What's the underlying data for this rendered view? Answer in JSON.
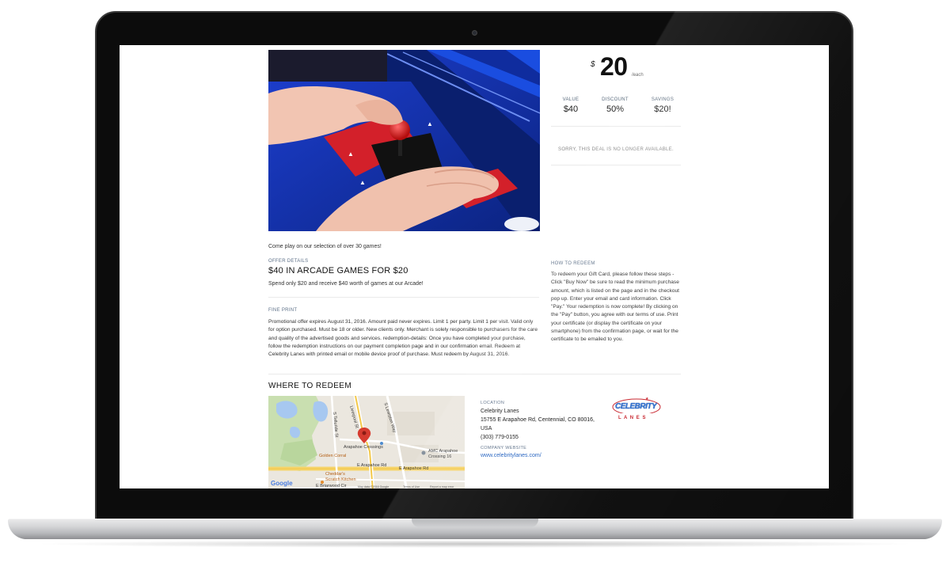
{
  "deal": {
    "currency_symbol": "$",
    "price": "20",
    "price_unit": "/each",
    "stats": [
      {
        "label": "VALUE",
        "value": "$40"
      },
      {
        "label": "DISCOUNT",
        "value": "50%"
      },
      {
        "label": "SAVINGS",
        "value": "$20!"
      }
    ],
    "status_message": "SORRY, THIS DEAL IS NO LONGER AVAILABLE."
  },
  "content": {
    "intro": "Come play on our selection of over 30 games!",
    "offer_details_label": "OFFER DETAILS",
    "offer_title": "$40 IN ARCADE GAMES FOR $20",
    "offer_description": "Spend only $20 and receive $40 worth of games at our Arcade!",
    "fine_print_label": "FINE PRINT",
    "fine_print": "Promotional offer expires August 31, 2016. Amount paid never expires. Limit 1 per party. Limit 1 per visit. Valid only for option purchased. Must be 18 or older. New clients only. Merchant is solely responsible to purchasers for the care and quality of the advertised goods and services. redemption-details: Once you have completed your purchase, follow the redemption instructions on our payment completion page and in our confirmation email. Redeem at Celebrity Lanes with printed email or mobile device proof of purchase. Must redeem by August 31, 2016.",
    "how_to_redeem_label": "HOW TO REDEEM",
    "how_to_redeem": "To redeem your Gift Card, please follow these steps - Click \"Buy Now\" be sure to read the minimum purchase amount, which is listed on the page and in the checkout pop up. Enter your email and card information. Click \"Pay.\" Your redemption is now complete! By clicking on the \"Pay\" button, you agree with our terms of use. Print your certificate (or display the certificate on your smartphone) from the confirmation page, or wait for the certificate to be emailed to you."
  },
  "where": {
    "title": "WHERE TO REDEEM",
    "location_label": "LOCATION",
    "name": "Celebrity Lanes",
    "address_line1": "15755 E Arapahoe Rd, Centennial, CO 80016,",
    "address_line2": "USA",
    "phone": "(303) 779-0155",
    "website_label": "COMPANY WEBSITE",
    "website": "www.celebritylanes.com/",
    "logo_text_top": "CELEBRITY",
    "logo_text_bottom": "L A N E S"
  },
  "map": {
    "labels": {
      "road_vertical": "Liverpool St",
      "road_right": "S Lewiston Way",
      "road_left": "S Telluride St",
      "crossings": "Arapahoe Crossings",
      "amc": "AMC Arapahoe",
      "amc2": "Crossing 16",
      "golden": "Golden Corral",
      "arapahoe_rd": "E Arapahoe Rd",
      "arapahoe_rd2": "E Arapahoe Rd",
      "cheddars": "Cheddar's",
      "scratch": "Scratch Kitchen",
      "briarwood": "E Briarwood Cir"
    },
    "google": "Google",
    "data_text": "Map data ©2016 Google",
    "terms": "Terms of Use",
    "report": "Report a map error"
  },
  "colors": {
    "accent_link": "#1f5fbf",
    "map_pin": "#d63b2f",
    "arcade_blue": "#0a2a8c",
    "joystick_red": "#e01f1f"
  }
}
